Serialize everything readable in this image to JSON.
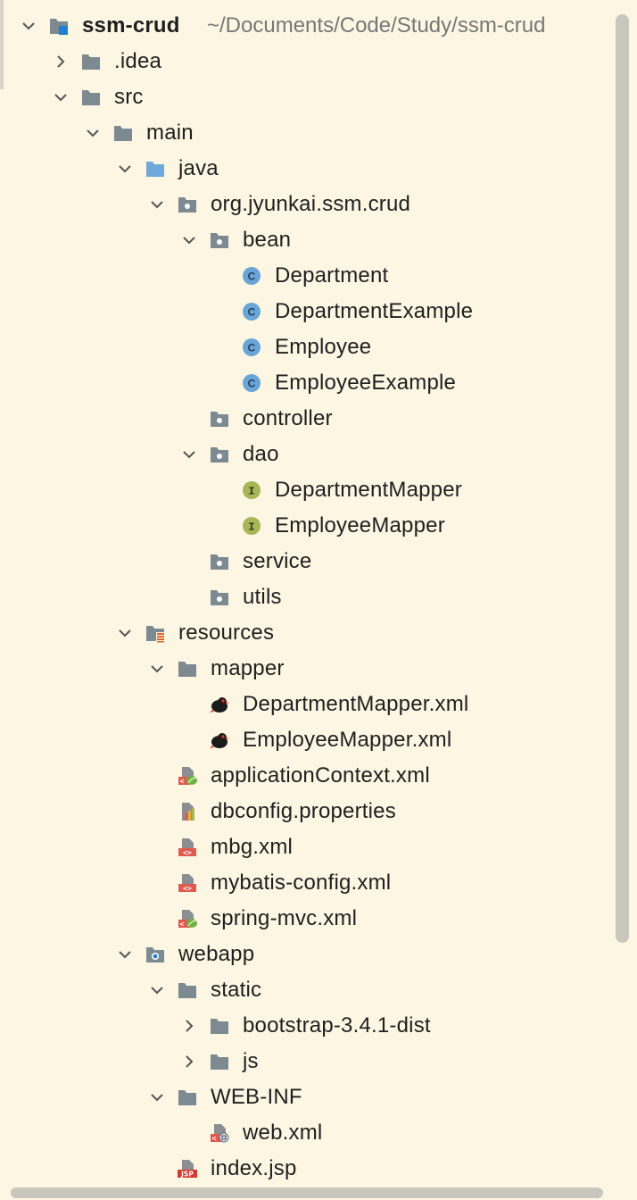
{
  "project": {
    "name": "ssm-crud",
    "path": "~/Documents/Code/Study/ssm-crud"
  },
  "tree": [
    {
      "label": "ssm-crud",
      "icon": "project-folder-icon",
      "depth": 0,
      "arrow": "expanded",
      "bold": true
    },
    {
      "label": ".idea",
      "icon": "folder-icon",
      "depth": 1,
      "arrow": "collapsed"
    },
    {
      "label": "src",
      "icon": "folder-icon",
      "depth": 1,
      "arrow": "expanded"
    },
    {
      "label": "main",
      "icon": "folder-icon",
      "depth": 2,
      "arrow": "expanded"
    },
    {
      "label": "java",
      "icon": "source-folder-icon",
      "depth": 3,
      "arrow": "expanded"
    },
    {
      "label": "org.jyunkai.ssm.crud",
      "icon": "package-icon",
      "depth": 4,
      "arrow": "expanded"
    },
    {
      "label": "bean",
      "icon": "package-icon",
      "depth": 5,
      "arrow": "expanded"
    },
    {
      "label": "Department",
      "icon": "class-icon",
      "depth": 6,
      "arrow": "none"
    },
    {
      "label": "DepartmentExample",
      "icon": "class-icon",
      "depth": 6,
      "arrow": "none"
    },
    {
      "label": "Employee",
      "icon": "class-icon",
      "depth": 6,
      "arrow": "none"
    },
    {
      "label": "EmployeeExample",
      "icon": "class-icon",
      "depth": 6,
      "arrow": "none"
    },
    {
      "label": "controller",
      "icon": "package-icon",
      "depth": 5,
      "arrow": "none"
    },
    {
      "label": "dao",
      "icon": "package-icon",
      "depth": 5,
      "arrow": "expanded"
    },
    {
      "label": "DepartmentMapper",
      "icon": "interface-icon",
      "depth": 6,
      "arrow": "none"
    },
    {
      "label": "EmployeeMapper",
      "icon": "interface-icon",
      "depth": 6,
      "arrow": "none"
    },
    {
      "label": "service",
      "icon": "package-icon",
      "depth": 5,
      "arrow": "none"
    },
    {
      "label": "utils",
      "icon": "package-icon",
      "depth": 5,
      "arrow": "none"
    },
    {
      "label": "resources",
      "icon": "resources-folder-icon",
      "depth": 3,
      "arrow": "expanded"
    },
    {
      "label": "mapper",
      "icon": "folder-icon",
      "depth": 4,
      "arrow": "expanded"
    },
    {
      "label": "DepartmentMapper.xml",
      "icon": "mybatis-bird-icon",
      "depth": 5,
      "arrow": "none"
    },
    {
      "label": "EmployeeMapper.xml",
      "icon": "mybatis-bird-icon",
      "depth": 5,
      "arrow": "none"
    },
    {
      "label": "applicationContext.xml",
      "icon": "spring-xml-icon",
      "depth": 4,
      "arrow": "none"
    },
    {
      "label": "dbconfig.properties",
      "icon": "properties-icon",
      "depth": 4,
      "arrow": "none"
    },
    {
      "label": "mbg.xml",
      "icon": "xml-icon",
      "depth": 4,
      "arrow": "none"
    },
    {
      "label": "mybatis-config.xml",
      "icon": "xml-icon",
      "depth": 4,
      "arrow": "none"
    },
    {
      "label": "spring-mvc.xml",
      "icon": "spring-xml-icon",
      "depth": 4,
      "arrow": "none"
    },
    {
      "label": "webapp",
      "icon": "web-folder-icon",
      "depth": 3,
      "arrow": "expanded"
    },
    {
      "label": "static",
      "icon": "folder-icon",
      "depth": 4,
      "arrow": "expanded"
    },
    {
      "label": "bootstrap-3.4.1-dist",
      "icon": "folder-icon",
      "depth": 5,
      "arrow": "collapsed"
    },
    {
      "label": "js",
      "icon": "folder-icon",
      "depth": 5,
      "arrow": "collapsed"
    },
    {
      "label": "WEB-INF",
      "icon": "folder-icon",
      "depth": 4,
      "arrow": "expanded"
    },
    {
      "label": "web.xml",
      "icon": "web-xml-icon",
      "depth": 5,
      "arrow": "none"
    },
    {
      "label": "index.jsp",
      "icon": "jsp-icon",
      "depth": 4,
      "arrow": "none"
    }
  ],
  "colors": {
    "background": "#fdf6e3",
    "folder": "#7e8a92",
    "source_folder": "#6fa8dc",
    "class": "#6aa5d8",
    "interface": "#a8b658",
    "xml_red": "#e05a4f",
    "spring_green": "#6db33f",
    "jsp_red": "#d9382f"
  }
}
